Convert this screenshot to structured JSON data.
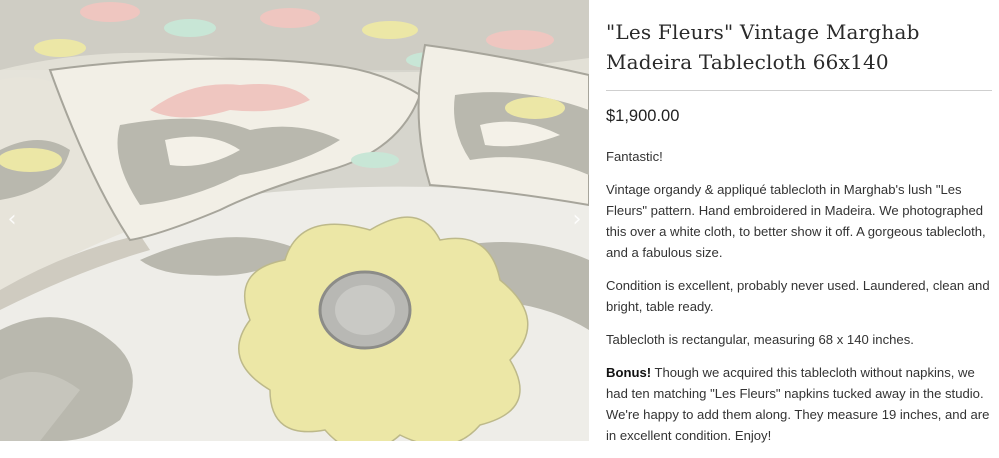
{
  "product": {
    "title": "\"Les Fleurs\" Vintage Marghab Madeira Tablecloth 66x140",
    "price": "$1,900.00",
    "description": {
      "p1": "Fantastic!",
      "p2": "Vintage organdy & appliqué tablecloth in Marghab's lush \"Les Fleurs\" pattern. Hand embroidered in Madeira. We photographed this over a white cloth, to better show it off. A gorgeous tablecloth, and a fabulous size.",
      "p3": "Condition is excellent, probably never used. Laundered, clean and bright, table ready.",
      "p4": "Tablecloth is rectangular, measuring 68 x 140 inches.",
      "bonus_label": "Bonus!",
      "bonus_text": " Though we acquired this tablecloth without napkins, we had ten matching \"Les Fleurs\" napkins tucked away in the studio. We're happy to add them along. They measure 19 inches, and are in excellent condition. Enjoy!"
    }
  },
  "gallery": {
    "prev_icon": "‹",
    "next_icon": "›"
  },
  "colors": {
    "linen": "#efece3",
    "applique_gray": "#b9b8ae",
    "flower_yellow": "#ece7a6",
    "flower_pink": "#efc6c0",
    "flower_mint": "#c8e6d6"
  }
}
